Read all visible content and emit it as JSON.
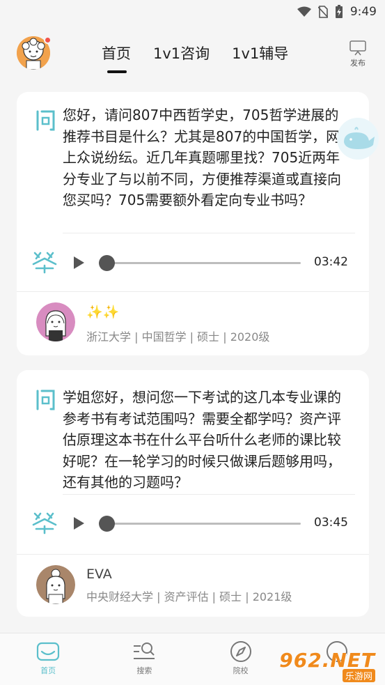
{
  "status_bar": {
    "time": "9:49"
  },
  "header": {
    "tabs": [
      {
        "label": "首页",
        "active": true
      },
      {
        "label": "1v1咨询",
        "active": false
      },
      {
        "label": "1v1辅导",
        "active": false
      }
    ],
    "publish_label": "发布"
  },
  "cards": [
    {
      "question": "您好，请问807中西哲学史，705哲学进展的推荐书目是什么？尤其是807的中国哲学，网上众说纷纭。近几年真题哪里找？705近两年分专业了与以前不同，方便推荐渠道或直接向您买吗？705需要额外看定向专业书吗？",
      "audio_duration": "03:42",
      "author_name": "✨✨",
      "author_info": "浙江大学 | 中国哲学 | 硕士 | 2020级"
    },
    {
      "question": "学姐您好，想问您一下考试的这几本专业课的参考书有考试范围吗？需要全都学吗？资产评估原理这本书在什么平台听什么老师的课比较好呢？在一轮学习的时候只做课后题够用吗，还有其他的习题吗？",
      "audio_duration": "03:45",
      "author_name": "EVA",
      "author_info": "中央财经大学 | 资产评估 | 硕士 | 2021级"
    }
  ],
  "bottom_nav": [
    {
      "label": "首页",
      "icon": "home-icon",
      "active": true
    },
    {
      "label": "搜索",
      "icon": "search-icon",
      "active": false
    },
    {
      "label": "院校",
      "icon": "compass-icon",
      "active": false
    },
    {
      "label": "",
      "icon": "profile-icon",
      "active": false
    }
  ],
  "watermark": {
    "brand": "962.NET",
    "caption": "乐游网"
  },
  "colors": {
    "accent": "#5bbfcb",
    "play_gray": "#555555",
    "background": "#f5f5f5"
  }
}
